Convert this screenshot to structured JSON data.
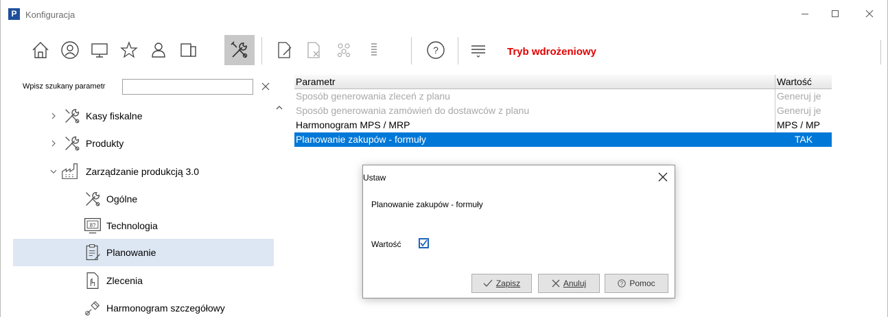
{
  "window": {
    "title": "Konfiguracja",
    "logo_letter": "P"
  },
  "toolbar": {
    "buttons": [
      "home-icon",
      "user-circle-icon",
      "monitor-icon",
      "star-icon",
      "user-icon",
      "devices-icon",
      "tools-icon",
      "document-edit-icon",
      "document-delete-icon",
      "group-icon",
      "list-icon",
      "help-icon",
      "filter-lines-icon"
    ],
    "active": "tools-icon",
    "mode_label": "Tryb wdrożeniowy"
  },
  "search": {
    "label": "Wpisz szukany parametr",
    "value": ""
  },
  "tree": {
    "items": [
      {
        "label": "Kasy fiskalne",
        "icon": "tools-icon",
        "chevron": "›",
        "level": 1
      },
      {
        "label": "Produkty",
        "icon": "tools-icon",
        "chevron": "›",
        "level": 1
      },
      {
        "label": "Zarządzanie produkcją 3.0",
        "icon": "factory-icon",
        "chevron": "⌄",
        "level": 1
      },
      {
        "label": "Ogólne",
        "icon": "tools-icon",
        "level": 2
      },
      {
        "label": "Technologia",
        "icon": "technology-icon",
        "level": 2
      },
      {
        "label": "Planowanie",
        "icon": "clipboard-icon",
        "level": 2,
        "selected": true
      },
      {
        "label": "Zlecenia",
        "icon": "order-icon",
        "level": 2
      },
      {
        "label": "Harmonogram szczegółowy",
        "icon": "schedule-icon",
        "level": 2
      }
    ]
  },
  "grid": {
    "columns": [
      "Parametr",
      "Wartość"
    ],
    "rows": [
      {
        "param": "Sposób generowania zleceń z planu",
        "value": "Generuj je",
        "state": "disabled"
      },
      {
        "param": "Sposób generowania zamówień do dostawców z planu",
        "value": "Generuj je",
        "state": "disabled"
      },
      {
        "param": "Harmonogram MPS / MRP",
        "value": "MPS / MP",
        "state": "normal"
      },
      {
        "param": "Planowanie zakupów - formuły",
        "value": "TAK",
        "state": "selected"
      }
    ]
  },
  "dialog": {
    "title": "Ustaw",
    "description": "Planowanie zakupów - formuły",
    "field_label": "Wartość",
    "checked": true,
    "buttons": {
      "save": "Zapisz",
      "cancel": "Anuluj",
      "help": "Pomoc"
    }
  },
  "colors": {
    "selection": "#0078d7",
    "mode_label": "#e10000",
    "tree_selected": "#dde7f3"
  }
}
